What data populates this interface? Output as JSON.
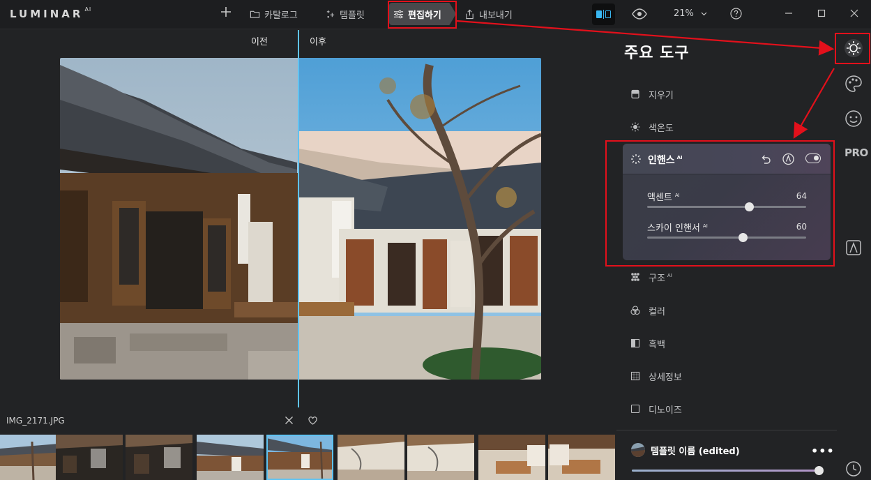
{
  "app": {
    "logo": "LUMINAR",
    "logo_suffix": "AI"
  },
  "nav": {
    "catalog": "카탈로그",
    "templates": "템플릿",
    "edit": "편집하기",
    "export": "내보내기"
  },
  "view": {
    "zoom": "21%"
  },
  "canvas": {
    "before_label": "이전",
    "after_label": "이후"
  },
  "filmstrip": {
    "filename": "IMG_2171.JPG",
    "thumb_count": 9,
    "active_index": 4
  },
  "panel": {
    "title": "주요 도구",
    "tools_top": [
      {
        "label": "지우기",
        "ai": ""
      },
      {
        "label": "색온도",
        "ai": ""
      }
    ],
    "enhance": {
      "title": "인핸스",
      "ai": "AI",
      "sliders": [
        {
          "label": "액센트",
          "ai": "AI",
          "value": "64",
          "fraction": 0.64
        },
        {
          "label": "스카이 인핸서",
          "ai": "AI",
          "value": "60",
          "fraction": 0.6
        }
      ]
    },
    "tools_bottom": [
      {
        "label": "구조",
        "ai": "AI"
      },
      {
        "label": "컬러",
        "ai": ""
      },
      {
        "label": "흑백",
        "ai": ""
      },
      {
        "label": "상세정보",
        "ai": ""
      },
      {
        "label": "디노이즈",
        "ai": ""
      }
    ],
    "template": {
      "name": "템플릿 이름 (edited)",
      "more": "•••",
      "amount_fraction": 1.0
    }
  },
  "rail": {
    "pro_label": "PRO"
  },
  "colors": {
    "accent": "#5fc3f2",
    "highlight": "#e3101b",
    "bg": "#222325"
  }
}
